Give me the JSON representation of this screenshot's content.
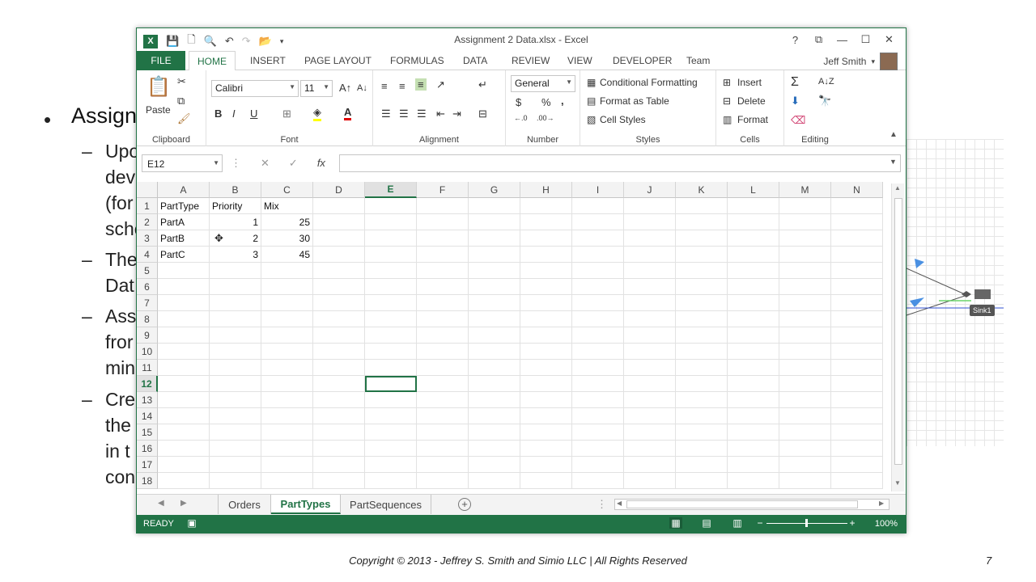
{
  "slide": {
    "bullet": "Assign",
    "sub_lines": [
      "Upo",
      "devi",
      "(for",
      "sche",
      "The",
      "Dat",
      "Ass",
      "fror",
      "min",
      "Cre",
      "the",
      "in t",
      "con"
    ],
    "copyright": "Copyright © 2013 - Jeffrey S. Smith and Simio LLC | All Rights Reserved",
    "page_number": "7",
    "sink_label": "Sink1"
  },
  "window": {
    "title": "Assignment 2 Data.xlsx - Excel",
    "help": "?",
    "user": "Jeff Smith"
  },
  "ribbon_tabs": [
    "FILE",
    "HOME",
    "INSERT",
    "PAGE LAYOUT",
    "FORMULAS",
    "DATA",
    "REVIEW",
    "VIEW",
    "DEVELOPER",
    "Team"
  ],
  "ribbon": {
    "clipboard": {
      "paste": "Paste",
      "label": "Clipboard"
    },
    "font": {
      "name": "Calibri",
      "size": "11",
      "bold": "B",
      "italic": "I",
      "underline": "U",
      "label": "Font"
    },
    "alignment": {
      "label": "Alignment"
    },
    "number": {
      "format": "General",
      "currency": "$",
      "percent": "%",
      "comma": ",",
      "label": "Number"
    },
    "styles": {
      "conditional": "Conditional Formatting",
      "table": "Format as Table",
      "cell": "Cell Styles",
      "label": "Styles"
    },
    "cells": {
      "insert": "Insert",
      "delete": "Delete",
      "format": "Format",
      "label": "Cells"
    },
    "editing": {
      "label": "Editing"
    }
  },
  "formula_bar": {
    "name_box": "E12",
    "fx": "fx",
    "value": ""
  },
  "columns": [
    "A",
    "B",
    "C",
    "D",
    "E",
    "F",
    "G",
    "H",
    "I",
    "J",
    "K",
    "L",
    "M",
    "N"
  ],
  "selected_column": "E",
  "rows": [
    "1",
    "2",
    "3",
    "4",
    "5",
    "6",
    "7",
    "8",
    "9",
    "10",
    "11",
    "12",
    "13",
    "14",
    "15",
    "16",
    "17",
    "18"
  ],
  "selected_row": "12",
  "cells": {
    "A1": "PartType",
    "B1": "Priority",
    "C1": "Mix",
    "A2": "PartA",
    "B2": "1",
    "C2": "25",
    "A3": "PartB",
    "B3": "2",
    "C3": "30",
    "A4": "PartC",
    "B4": "3",
    "C4": "45"
  },
  "sheets": [
    "Orders",
    "PartTypes",
    "PartSequences"
  ],
  "active_sheet": "PartTypes",
  "status": {
    "ready": "READY",
    "zoom": "100%"
  },
  "colors": {
    "excel_green": "#217346",
    "grid_line": "#e2e2e2"
  }
}
